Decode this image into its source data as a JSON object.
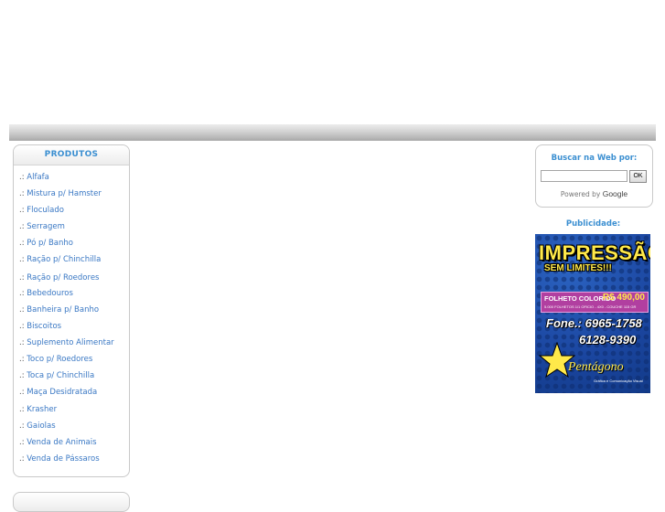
{
  "menu": {
    "title": "PRODUTOS",
    "items": [
      {
        "bullet": ".:",
        "label": "Alfafa"
      },
      {
        "bullet": ".:",
        "label": "Mistura p/ Hamster"
      },
      {
        "bullet": ".:",
        "label": "Floculado"
      },
      {
        "bullet": ".:",
        "label": "Serragem"
      },
      {
        "bullet": ".:",
        "label": "Pó p/ Banho"
      },
      {
        "bullet": ".:",
        "label": "Ração p/ Chinchilla"
      },
      {
        "bullet": ".:",
        "label": "Ração p/ Roedores"
      },
      {
        "bullet": ".:",
        "label": "Bebedouros"
      },
      {
        "bullet": ".:",
        "label": "Banheira p/ Banho"
      },
      {
        "bullet": ".:",
        "label": "Biscoitos"
      },
      {
        "bullet": ".:",
        "label": "Suplemento Alimentar"
      },
      {
        "bullet": ".:",
        "label": "Toco p/ Roedores"
      },
      {
        "bullet": ".:",
        "label": "Toca p/ Chinchilla"
      },
      {
        "bullet": ".:",
        "label": "Maça Desidratada"
      },
      {
        "bullet": ".:",
        "label": "Krasher"
      },
      {
        "bullet": ".:",
        "label": "Gaiolas"
      },
      {
        "bullet": ".:",
        "label": "Venda de Animais"
      },
      {
        "bullet": ".:",
        "label": "Venda de Pássaros"
      }
    ]
  },
  "search": {
    "title": "Buscar na Web por:",
    "input_value": "",
    "button_label": "OK",
    "powered_prefix": "Powered by",
    "powered_brand": "Google"
  },
  "ads": {
    "label": "Publicidade:",
    "banner": {
      "headline": "IMPRESSÃO",
      "subheadline": "SEM LIMITES!!!",
      "offer_label": "FOLHETO COLORIDO",
      "offer_price": "R$ 490,00",
      "offer_fineprint": "5.000 FOLHETOS 1/1 OFICIO - 4X0 - COUCHE 115 GR",
      "phone_1": "Fone.: 6965-1758",
      "phone_2": "6128-9390",
      "brand": "Pentágono",
      "brand_sub": "Gráfica e Comunicação Visual",
      "colors": {
        "background": "#1f4fa6",
        "accent": "#ffe94a",
        "strip": "#b13fa0"
      }
    }
  }
}
